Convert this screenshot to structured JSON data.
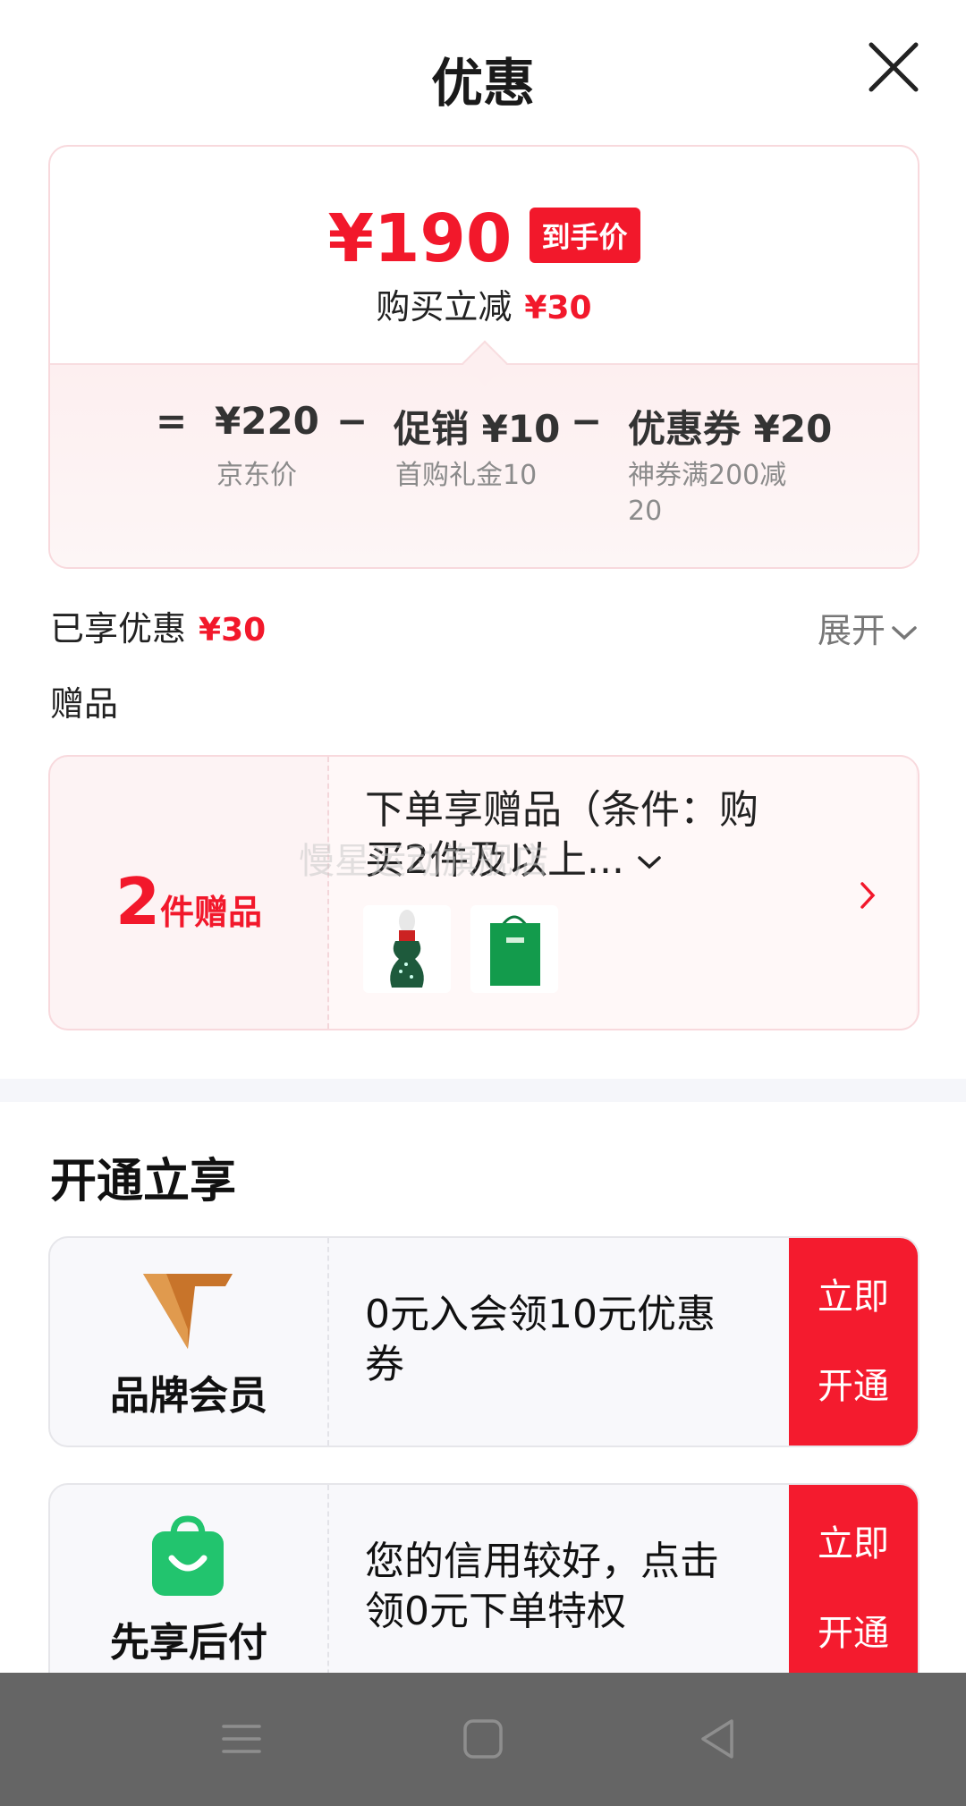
{
  "header": {
    "title": "优惠"
  },
  "price": {
    "final_price": "¥190",
    "final_badge": "到手价",
    "save_text": "购买立减",
    "save_amount": "¥30",
    "eq_sign": "=",
    "minus_sign": "−",
    "jd_price": "¥220",
    "jd_label": "京东价",
    "promo_price": "促销 ¥10",
    "promo_label": "首购礼金10",
    "coupon_price": "优惠券 ¥20",
    "coupon_label_line1": "神券满200减",
    "coupon_label_line2": "20"
  },
  "summary": {
    "enjoyed_label": "已享优惠",
    "enjoyed_amount": "¥30",
    "expand_label": "展开",
    "gift_heading": "赠品"
  },
  "gift": {
    "count": "2",
    "count_unit": "件赠品",
    "desc_line1": "下单享赠品（条件：购",
    "desc_line2": "买2件及以上...",
    "watermark": "慢星运动旗舰店"
  },
  "section": {
    "title": "开通立享"
  },
  "offers": [
    {
      "name": "品牌会员",
      "desc_line1": "0元入会领10元优惠",
      "desc_line2": "券",
      "btn_line1": "立即",
      "btn_line2": "开通"
    },
    {
      "name": "先享后付",
      "desc_line1": "您的信用较好，点击",
      "desc_line2": "领0元下单特权",
      "btn_line1": "立即",
      "btn_line2": "开通"
    }
  ],
  "colors": {
    "accent": "#f2182b",
    "nav_bg": "#656565",
    "pay_green": "#22c46e",
    "member_orange": "#c8742a"
  }
}
